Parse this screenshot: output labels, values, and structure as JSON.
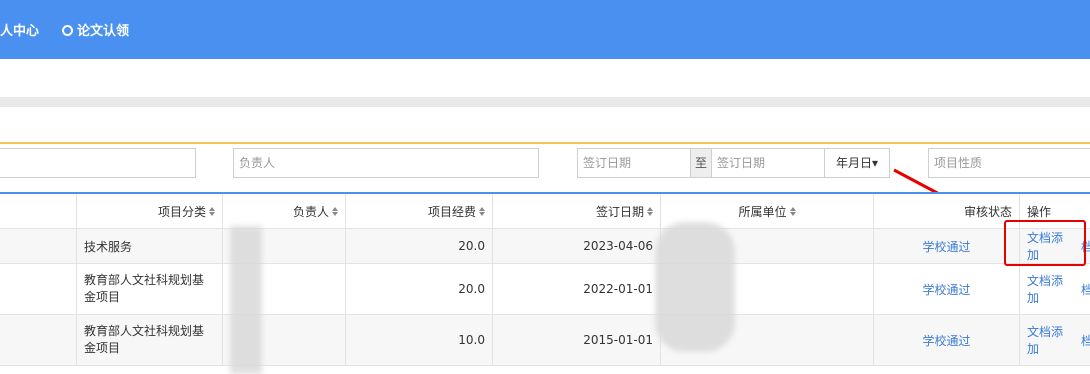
{
  "nav": {
    "item1": "人中心",
    "item2": "论文认领"
  },
  "filters": {
    "leader_placeholder": "负责人",
    "date_start_placeholder": "签订日期",
    "to_label": "至",
    "date_end_placeholder": "签订日期",
    "date_unit": "年月日▾",
    "nature_placeholder": "项目性质"
  },
  "table": {
    "columns": [
      "项目分类",
      "负责人",
      "项目经费",
      "签订日期",
      "所属单位",
      "审核状态",
      "操作"
    ],
    "rows": [
      {
        "category": "技术服务",
        "leader": "",
        "fund": "20.0",
        "date": "2023-04-06",
        "unit": "",
        "status": "学校通过",
        "action": "文档添加",
        "action2": "档"
      },
      {
        "category": "教育部人文社科规划基金项目",
        "leader": "",
        "fund": "20.0",
        "date": "2022-01-01",
        "unit": "",
        "status": "学校通过",
        "action": "文档添加",
        "action2": "档"
      },
      {
        "category": "教育部人文社科规划基金项目",
        "leader": "",
        "fund": "10.0",
        "date": "2015-01-01",
        "unit": "",
        "status": "学校通过",
        "action": "文档添加",
        "action2": "档"
      }
    ]
  },
  "colors": {
    "primary": "#4990f0",
    "link": "#3a7bd5",
    "highlight": "#e60000"
  }
}
